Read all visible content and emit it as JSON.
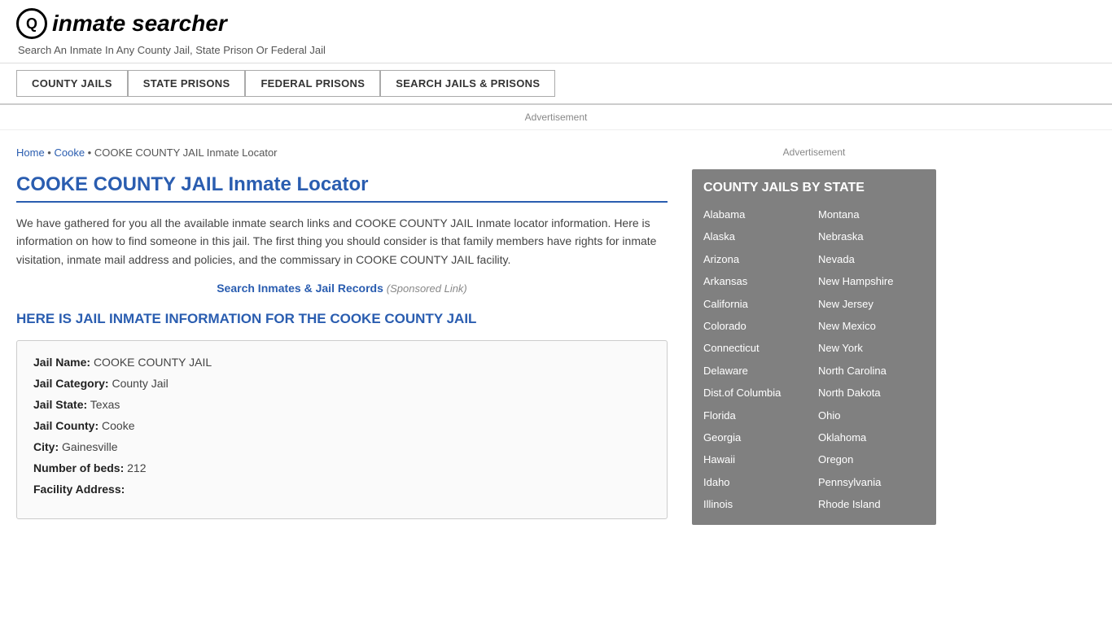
{
  "header": {
    "logo_icon": "🔍",
    "logo_text": "inmate searcher",
    "tagline": "Search An Inmate In Any County Jail, State Prison Or Federal Jail"
  },
  "nav": {
    "items": [
      {
        "label": "COUNTY JAILS",
        "id": "county-jails"
      },
      {
        "label": "STATE PRISONS",
        "id": "state-prisons"
      },
      {
        "label": "FEDERAL PRISONS",
        "id": "federal-prisons"
      },
      {
        "label": "SEARCH JAILS & PRISONS",
        "id": "search-jails"
      }
    ]
  },
  "ad_bar": "Advertisement",
  "breadcrumb": {
    "home": "Home",
    "cooke": "Cooke",
    "current": "COOKE COUNTY JAIL Inmate Locator"
  },
  "page_title": "COOKE COUNTY JAIL Inmate Locator",
  "description": "We have gathered for you all the available inmate search links and COOKE COUNTY JAIL Inmate locator information. Here is information on how to find someone in this jail. The first thing you should consider is that family members have rights for inmate visitation, inmate mail address and policies, and the commissary in COOKE COUNTY JAIL facility.",
  "sponsored_link_text": "Search Inmates & Jail Records",
  "sponsored_label": "(Sponsored Link)",
  "sub_heading": "HERE IS JAIL INMATE INFORMATION FOR THE COOKE COUNTY JAIL",
  "jail_info": {
    "name_label": "Jail Name:",
    "name_value": "COOKE COUNTY JAIL",
    "category_label": "Jail Category:",
    "category_value": "County Jail",
    "state_label": "Jail State:",
    "state_value": "Texas",
    "county_label": "Jail County:",
    "county_value": "Cooke",
    "city_label": "City:",
    "city_value": "Gainesville",
    "beds_label": "Number of beds:",
    "beds_value": "212",
    "address_label": "Facility Address:"
  },
  "sidebar": {
    "ad_text": "Advertisement",
    "section_title": "COUNTY JAILS BY STATE",
    "states_col1": [
      "Alabama",
      "Alaska",
      "Arizona",
      "Arkansas",
      "California",
      "Colorado",
      "Connecticut",
      "Delaware",
      "Dist.of Columbia",
      "Florida",
      "Georgia",
      "Hawaii",
      "Idaho",
      "Illinois"
    ],
    "states_col2": [
      "Montana",
      "Nebraska",
      "Nevada",
      "New Hampshire",
      "New Jersey",
      "New Mexico",
      "New York",
      "North Carolina",
      "North Dakota",
      "Ohio",
      "Oklahoma",
      "Oregon",
      "Pennsylvania",
      "Rhode Island"
    ]
  }
}
